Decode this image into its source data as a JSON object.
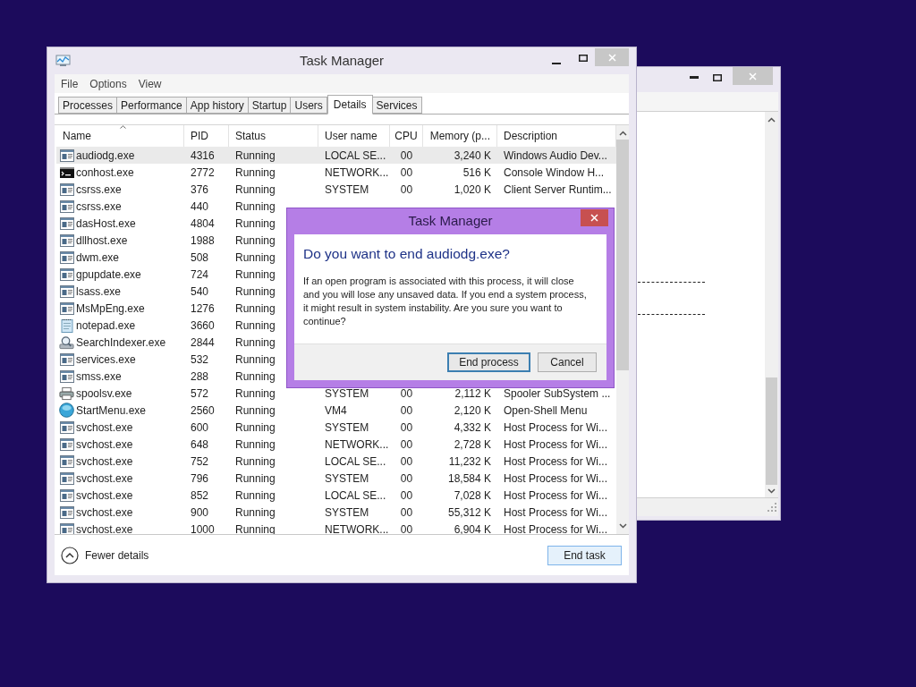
{
  "window": {
    "title": "Task Manager"
  },
  "menu": [
    "File",
    "Options",
    "View"
  ],
  "tabs": [
    {
      "label": "Processes",
      "selected": false
    },
    {
      "label": "Performance",
      "selected": false
    },
    {
      "label": "App history",
      "selected": false
    },
    {
      "label": "Startup",
      "selected": false
    },
    {
      "label": "Users",
      "selected": false
    },
    {
      "label": "Details",
      "selected": true
    },
    {
      "label": "Services",
      "selected": false
    }
  ],
  "table": {
    "columns": [
      {
        "label": "Name",
        "sorted": true
      },
      {
        "label": "PID",
        "sorted": false
      },
      {
        "label": "Status",
        "sorted": false
      },
      {
        "label": "User name",
        "sorted": false
      },
      {
        "label": "CPU",
        "sorted": false
      },
      {
        "label": "Memory (p...",
        "sorted": false
      },
      {
        "label": "Description",
        "sorted": false
      }
    ],
    "rows": [
      {
        "kind": "app",
        "name": "audiodg.exe",
        "pid": "4316",
        "status": "Running",
        "user": "LOCAL SE...",
        "cpu": "00",
        "memory": "3,240 K",
        "description": "Windows Audio Dev...",
        "selected": true
      },
      {
        "kind": "console",
        "name": "conhost.exe",
        "pid": "2772",
        "status": "Running",
        "user": "NETWORK...",
        "cpu": "00",
        "memory": "516 K",
        "description": "Console Window H...",
        "selected": false
      },
      {
        "kind": "app",
        "name": "csrss.exe",
        "pid": "376",
        "status": "Running",
        "user": "SYSTEM",
        "cpu": "00",
        "memory": "1,020 K",
        "description": "Client Server Runtim...",
        "selected": false
      },
      {
        "kind": "app",
        "name": "csrss.exe",
        "pid": "440",
        "status": "Running",
        "selected": false
      },
      {
        "kind": "app",
        "name": "dasHost.exe",
        "pid": "4804",
        "status": "Running",
        "selected": false
      },
      {
        "kind": "app",
        "name": "dllhost.exe",
        "pid": "1988",
        "status": "Running",
        "selected": false
      },
      {
        "kind": "app",
        "name": "dwm.exe",
        "pid": "508",
        "status": "Running",
        "selected": false
      },
      {
        "kind": "app",
        "name": "gpupdate.exe",
        "pid": "724",
        "status": "Running",
        "selected": false
      },
      {
        "kind": "app",
        "name": "lsass.exe",
        "pid": "540",
        "status": "Running",
        "selected": false
      },
      {
        "kind": "app",
        "name": "MsMpEng.exe",
        "pid": "1276",
        "status": "Running",
        "selected": false
      },
      {
        "kind": "notepad",
        "name": "notepad.exe",
        "pid": "3660",
        "status": "Running",
        "selected": false
      },
      {
        "kind": "search",
        "name": "SearchIndexer.exe",
        "pid": "2844",
        "status": "Running",
        "selected": false
      },
      {
        "kind": "app",
        "name": "services.exe",
        "pid": "532",
        "status": "Running",
        "selected": false
      },
      {
        "kind": "app",
        "name": "smss.exe",
        "pid": "288",
        "status": "Running",
        "selected": false
      },
      {
        "kind": "printer",
        "name": "spoolsv.exe",
        "pid": "572",
        "status": "Running",
        "user": "SYSTEM",
        "cpu": "00",
        "memory": "2,112 K",
        "description": "Spooler SubSystem ...",
        "selected": false
      },
      {
        "kind": "globe",
        "name": "StartMenu.exe",
        "pid": "2560",
        "status": "Running",
        "user": "VM4",
        "cpu": "00",
        "memory": "2,120 K",
        "description": "Open-Shell Menu",
        "selected": false
      },
      {
        "kind": "app",
        "name": "svchost.exe",
        "pid": "600",
        "status": "Running",
        "user": "SYSTEM",
        "cpu": "00",
        "memory": "4,332 K",
        "description": "Host Process for Wi...",
        "selected": false
      },
      {
        "kind": "app",
        "name": "svchost.exe",
        "pid": "648",
        "status": "Running",
        "user": "NETWORK...",
        "cpu": "00",
        "memory": "2,728 K",
        "description": "Host Process for Wi...",
        "selected": false
      },
      {
        "kind": "app",
        "name": "svchost.exe",
        "pid": "752",
        "status": "Running",
        "user": "LOCAL SE...",
        "cpu": "00",
        "memory": "11,232 K",
        "description": "Host Process for Wi...",
        "selected": false
      },
      {
        "kind": "app",
        "name": "svchost.exe",
        "pid": "796",
        "status": "Running",
        "user": "SYSTEM",
        "cpu": "00",
        "memory": "18,584 K",
        "description": "Host Process for Wi...",
        "selected": false
      },
      {
        "kind": "app",
        "name": "svchost.exe",
        "pid": "852",
        "status": "Running",
        "user": "LOCAL SE...",
        "cpu": "00",
        "memory": "7,028 K",
        "description": "Host Process for Wi...",
        "selected": false
      },
      {
        "kind": "app",
        "name": "svchost.exe",
        "pid": "900",
        "status": "Running",
        "user": "SYSTEM",
        "cpu": "00",
        "memory": "55,312 K",
        "description": "Host Process for Wi...",
        "selected": false
      },
      {
        "kind": "app",
        "name": "svchost.exe",
        "pid": "1000",
        "status": "Running",
        "user": "NETWORK...",
        "cpu": "00",
        "memory": "6,904 K",
        "description": "Host Process for Wi...",
        "selected": false
      }
    ]
  },
  "footer": {
    "toggle": "Fewer details",
    "button": "End task"
  },
  "dialog": {
    "title": "Task Manager",
    "heading": "Do you want to end audiodg.exe?",
    "message": "If an open program is associated with this process, it will close and you will lose any unsaved data. If you end a system process, it might result in system instability. Are you sure you want to continue?",
    "buttons": [
      {
        "label": "End process",
        "default": true
      },
      {
        "label": "Cancel",
        "default": false
      }
    ]
  }
}
